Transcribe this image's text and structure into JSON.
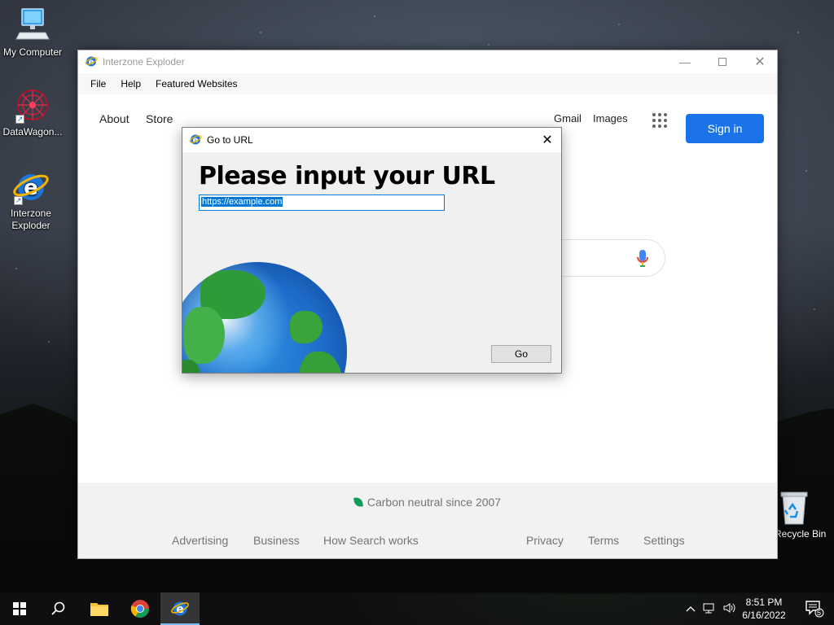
{
  "desktop": {
    "icons": [
      {
        "label": "My Computer"
      },
      {
        "label": "DataWagon..."
      },
      {
        "label": "Interzone Exploder"
      },
      {
        "label": "Recycle Bin"
      }
    ]
  },
  "window": {
    "title": "Interzone Exploder",
    "menu": [
      "File",
      "Help",
      "Featured Websites"
    ]
  },
  "page": {
    "nav_left": [
      "About",
      "Store"
    ],
    "nav_right": [
      "Gmail",
      "Images"
    ],
    "signin_label": "Sign in",
    "footer": {
      "carbon": "Carbon neutral since 2007",
      "links_left": [
        "Advertising",
        "Business",
        "How Search works"
      ],
      "links_right": [
        "Privacy",
        "Terms",
        "Settings"
      ]
    }
  },
  "dialog": {
    "title": "Go to URL",
    "heading": "Please input your URL",
    "url_value": "https://example.com",
    "go_label": "Go"
  },
  "taskbar": {
    "time": "8:51 PM",
    "date": "6/16/2022",
    "notification_count": "5"
  },
  "colors": {
    "accent": "#1a73e8",
    "selection": "#0078d7"
  }
}
